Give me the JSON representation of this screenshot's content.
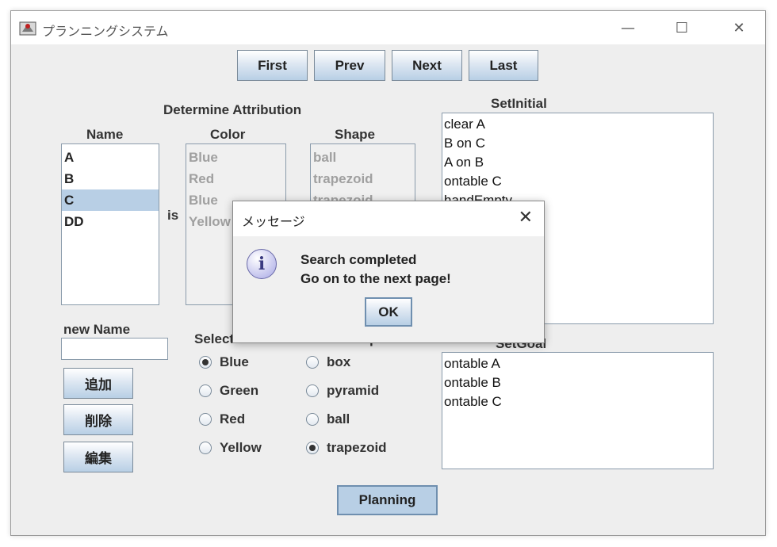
{
  "window": {
    "title": "プランニングシステム",
    "minimize": "—",
    "maximize": "☐",
    "close": "✕"
  },
  "nav": {
    "first": "First",
    "prev": "Prev",
    "next": "Next",
    "last": "Last"
  },
  "section_title": "Determine Attribution",
  "columns": {
    "name": "Name",
    "color": "Color",
    "shape": "Shape",
    "is": "is"
  },
  "name_list": [
    "A",
    "B",
    "C",
    "DD"
  ],
  "name_selected": "C",
  "color_list": [
    "Blue",
    "Red",
    "Blue",
    "Yellow"
  ],
  "shape_list": [
    "ball",
    "trapezoid",
    "trapezoid"
  ],
  "new_name": {
    "label": "new Name",
    "value": ""
  },
  "buttons": {
    "add": "追加",
    "delete": "削除",
    "edit": "編集",
    "planning": "Planning"
  },
  "select_color": {
    "label": "Select Color",
    "options": [
      "Blue",
      "Green",
      "Red",
      "Yellow"
    ],
    "selected": "Blue"
  },
  "select_shape": {
    "label": "Select Shape",
    "options": [
      "box",
      "pyramid",
      "ball",
      "trapezoid"
    ],
    "selected": "trapezoid"
  },
  "set_initial": {
    "label": "SetInitial",
    "lines": [
      "clear A",
      "B on C",
      "A on B",
      "ontable C",
      "handEmpty"
    ]
  },
  "set_goal": {
    "label": "SetGoal",
    "lines": [
      "ontable A",
      "ontable B",
      "ontable C"
    ]
  },
  "dialog": {
    "title": "メッセージ",
    "close": "✕",
    "icon": "info-icon",
    "line1": "Search completed",
    "line2": "Go on to the next page!",
    "ok": "OK"
  }
}
